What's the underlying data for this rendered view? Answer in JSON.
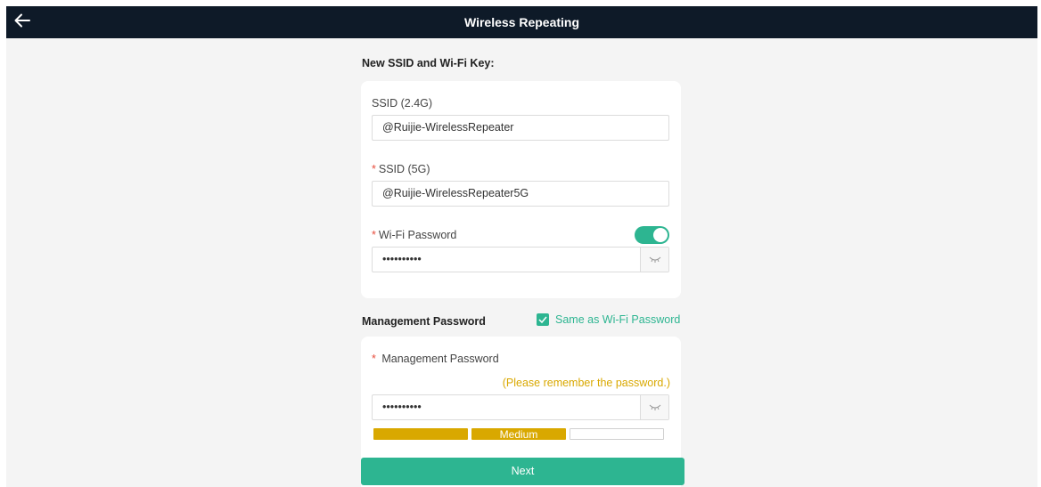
{
  "header": {
    "title": "Wireless Repeating",
    "back_icon": "arrow-left-icon"
  },
  "ssid_section": {
    "title": "New SSID and Wi-Fi Key:",
    "ssid_24g": {
      "label": "SSID (2.4G)",
      "value": "@Ruijie-WirelessRepeater"
    },
    "ssid_5g": {
      "required_mark": "*",
      "label": "SSID (5G)",
      "value": "@Ruijie-WirelessRepeater5G"
    },
    "wifi_password": {
      "required_mark": "*",
      "label": "Wi-Fi Password",
      "value": "••••••••••",
      "enabled": true,
      "eye_icon": "eye-closed-icon"
    }
  },
  "management_section": {
    "title": "Management Password",
    "same_as_wifi": {
      "label": "Same as Wi-Fi Password",
      "checked": true
    },
    "password": {
      "required_mark": "*",
      "label": "Management Password",
      "hint": "(Please remember the password.)",
      "value": "••••••••••",
      "eye_icon": "eye-closed-icon"
    },
    "strength": {
      "level": 2,
      "of": 3,
      "label": "Medium"
    }
  },
  "footer": {
    "next_label": "Next"
  },
  "colors": {
    "header_bg": "#0e1a28",
    "accent": "#2db591",
    "warning": "#d9a800",
    "required": "#e74c3c"
  }
}
